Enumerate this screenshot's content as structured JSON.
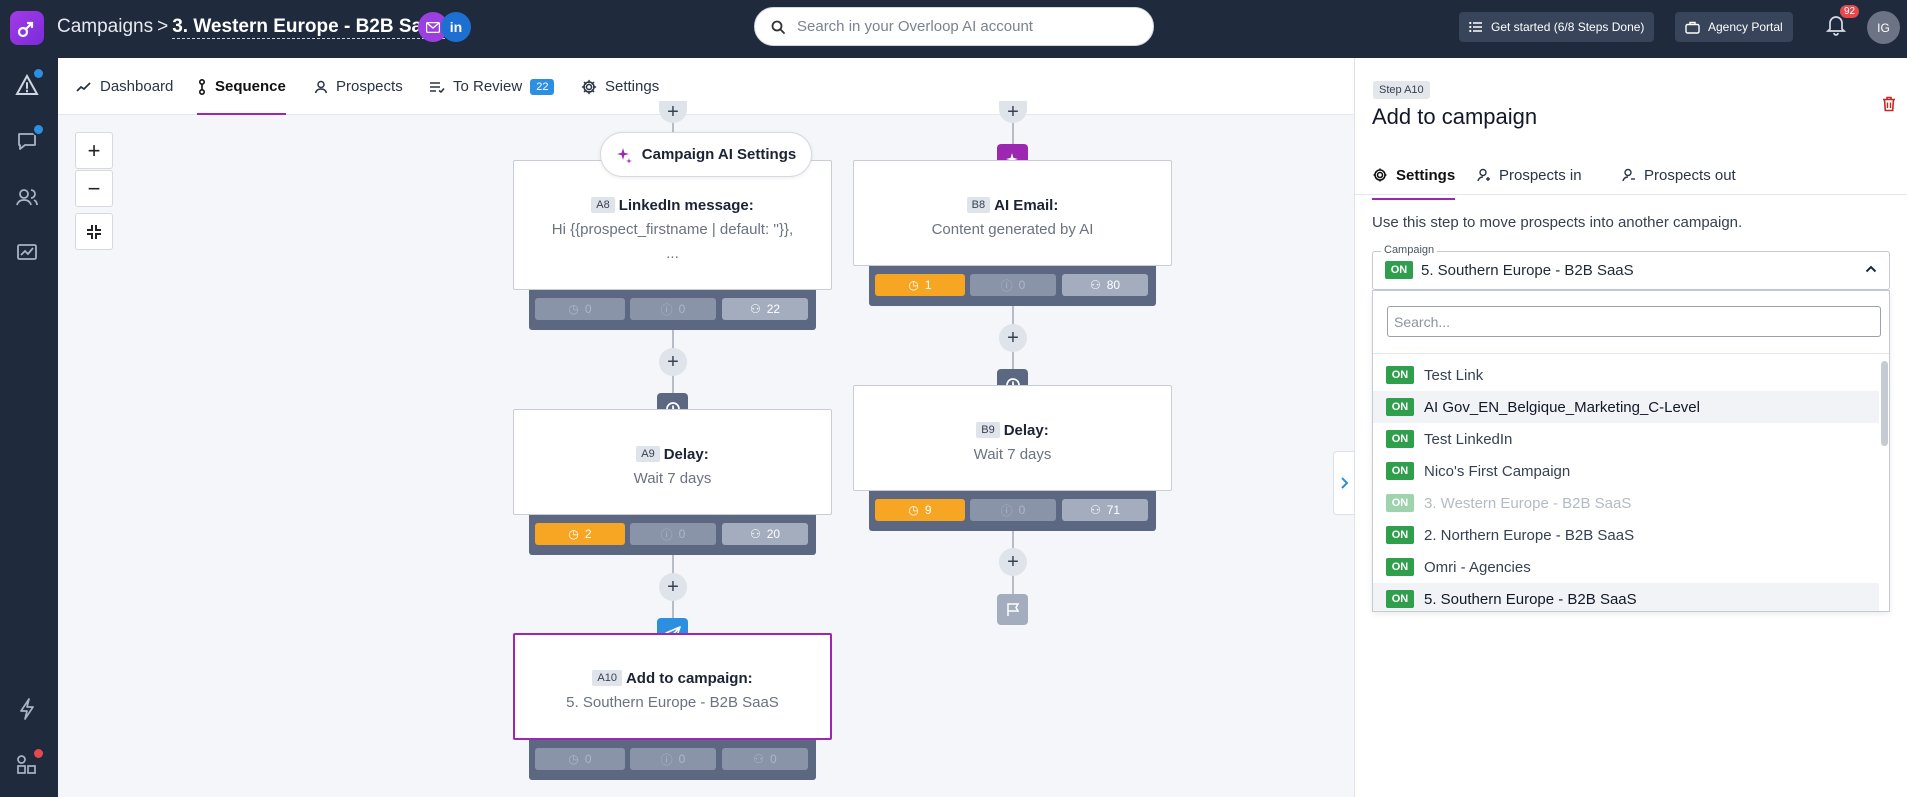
{
  "header": {
    "crumb_root": "Campaigns",
    "crumb_sep": ">",
    "crumb_current": "3. Western Europe - B2B SaaS",
    "linkedin_label": "in",
    "search_placeholder": "Search in your Overloop AI account",
    "get_started": "Get started (6/8 Steps Done)",
    "agency_portal": "Agency Portal",
    "notif_count": "92",
    "avatar_initials": "IG"
  },
  "tabs": {
    "dashboard": "Dashboard",
    "sequence": "Sequence",
    "prospects": "Prospects",
    "review": "To Review",
    "review_count": "22",
    "settings": "Settings"
  },
  "canvas": {
    "ai_settings": "Campaign AI Settings",
    "a8": {
      "tag": "A8",
      "title": "LinkedIn message:",
      "line1": "Hi {{prospect_firstname | default: ''}},",
      "line2": "...",
      "s1": "0",
      "s2": "0",
      "s3": "22"
    },
    "b8": {
      "tag": "B8",
      "title": "AI Email:",
      "line1": "Content generated by AI",
      "s1": "1",
      "s2": "0",
      "s3": "80"
    },
    "a9": {
      "tag": "A9",
      "title": "Delay:",
      "line1": "Wait 7 days",
      "s1": "2",
      "s2": "0",
      "s3": "20"
    },
    "b9": {
      "tag": "B9",
      "title": "Delay:",
      "line1": "Wait 7 days",
      "s1": "9",
      "s2": "0",
      "s3": "71"
    },
    "a10": {
      "tag": "A10",
      "title": "Add to campaign:",
      "line1": "5. Southern Europe - B2B SaaS",
      "s1": "0",
      "s2": "0",
      "s3": "0"
    }
  },
  "panel": {
    "step_tag": "Step A10",
    "title": "Add to campaign",
    "tab_settings": "Settings",
    "tab_in": "Prospects in",
    "tab_out": "Prospects out",
    "description": "Use this step to move prospects into another campaign.",
    "field_label": "Campaign",
    "on_label": "ON",
    "selected": "5. Southern Europe - B2B SaaS",
    "search_placeholder": "Search...",
    "options": [
      "Test Link",
      "AI Gov_EN_Belgique_Marketing_C-Level",
      "Test LinkedIn",
      "Nico's First Campaign",
      "3. Western Europe - B2B SaaS",
      "2. Northern Europe - B2B SaaS",
      "Omri - Agencies",
      "5. Southern Europe - B2B SaaS"
    ]
  },
  "colors": {
    "accent": "#9c27b0",
    "navy": "#1f2a3d",
    "on_green": "#2f9e4d",
    "stat_orange": "#f6a623"
  }
}
